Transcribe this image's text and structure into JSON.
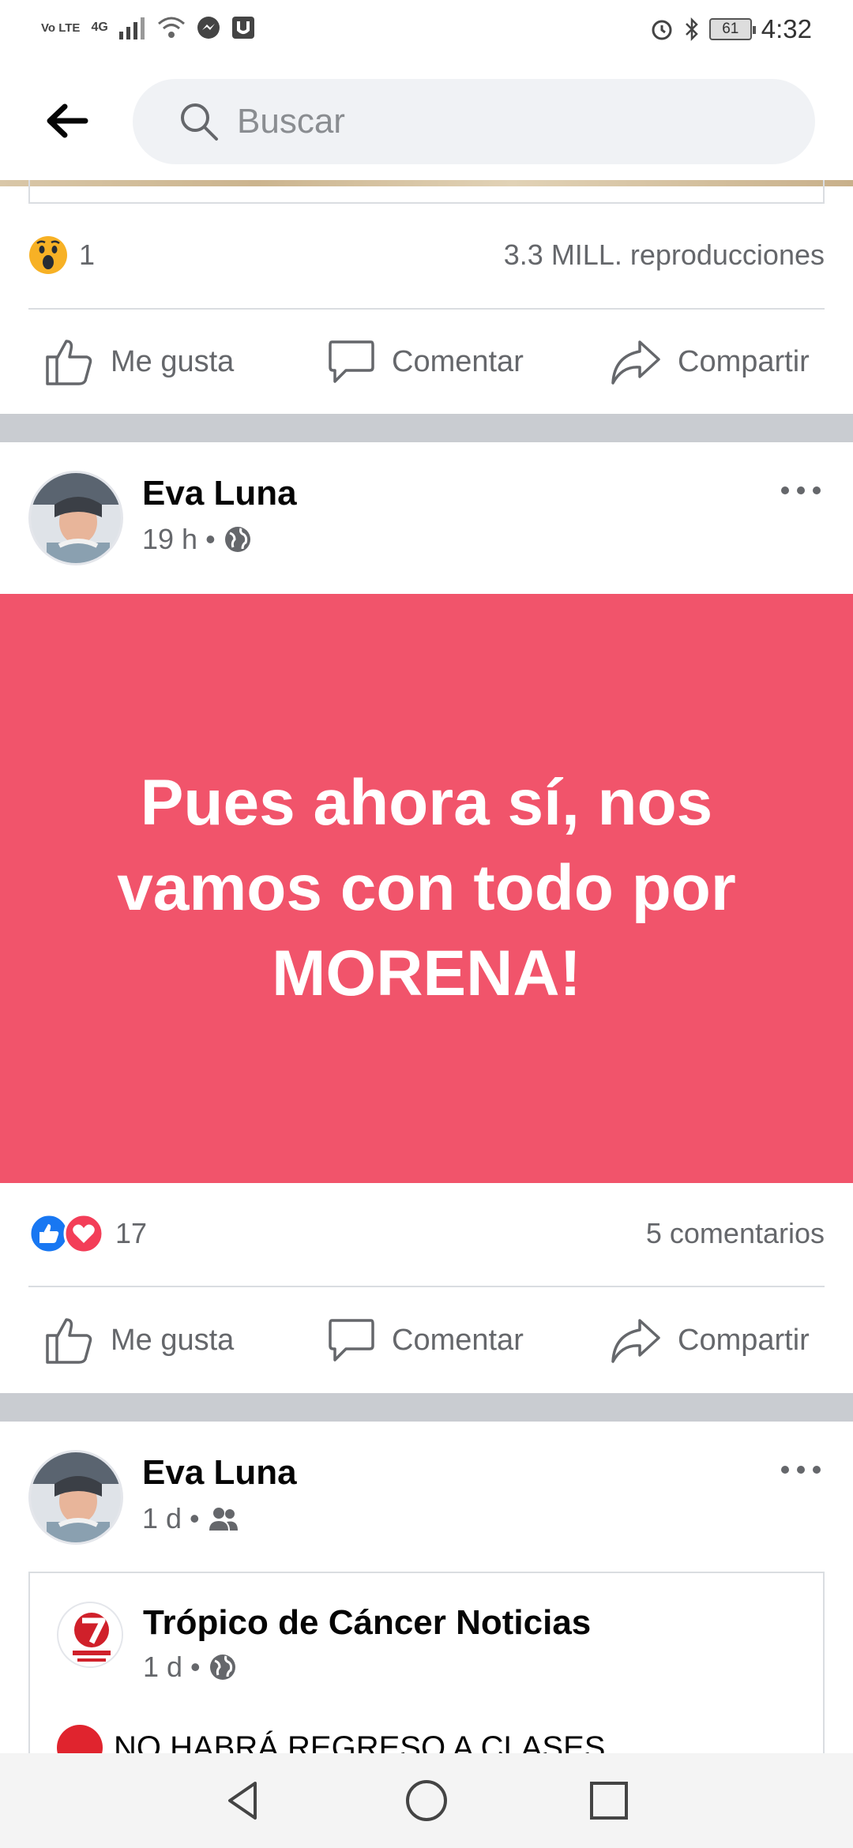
{
  "status_bar": {
    "time": "4:32",
    "battery": "61",
    "network": "4G",
    "volte": "Vo LTE"
  },
  "search": {
    "placeholder": "Buscar"
  },
  "post1": {
    "reaction_count": "1",
    "views": "3.3 MILL. reproducciones"
  },
  "actions": {
    "like": "Me gusta",
    "comment": "Comentar",
    "share": "Compartir"
  },
  "post2": {
    "author": "Eva Luna",
    "time": "19 h",
    "separator": "•",
    "banner_text": "Pues ahora sí, nos vamos con todo por MORENA!",
    "reaction_count": "17",
    "comments": "5 comentarios"
  },
  "post3": {
    "author": "Eva Luna",
    "time": "1 d",
    "separator": "•",
    "shared_page": "Trópico de Cáncer Noticias",
    "shared_time": "1 d",
    "shared_text": "NO HABRÁ REGRESO A CLASES"
  },
  "colors": {
    "banner": "#f1546b",
    "like_blue": "#1877f2",
    "love_red": "#f33e58"
  }
}
